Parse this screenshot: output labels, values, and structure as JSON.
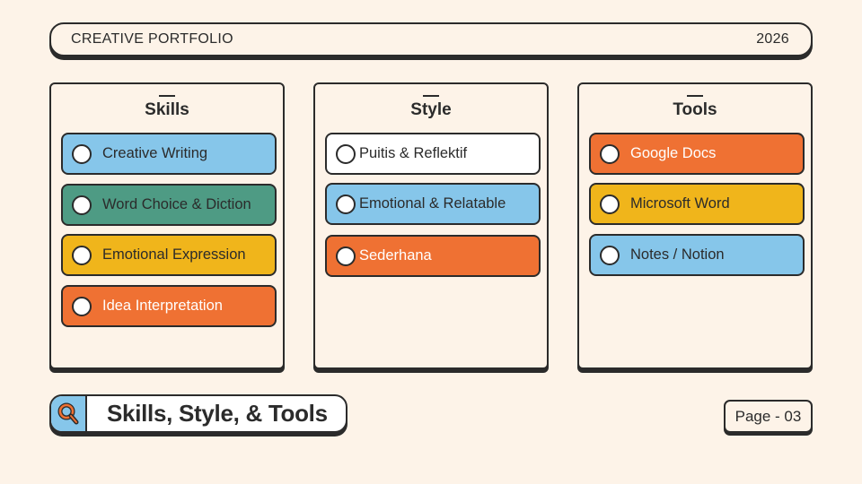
{
  "header": {
    "title": "CREATIVE PORTFOLIO",
    "year": "2026"
  },
  "columns": [
    {
      "title": "Skills",
      "items": [
        {
          "label": "Creative Writing",
          "color": "#86c6ea"
        },
        {
          "label": "Word Choice & Diction",
          "color": "#4e9b84"
        },
        {
          "label": "Emotional Expression",
          "color": "#f0b51b"
        },
        {
          "label": "Idea Interpretation",
          "color": "#ef7133"
        }
      ]
    },
    {
      "title": "Style",
      "items": [
        {
          "label": "Puitis & Reflektif",
          "color": "#ffffff"
        },
        {
          "label": "Emotional & Relatable",
          "color": "#86c6ea"
        },
        {
          "label": "Sederhana",
          "color": "#ef7133"
        }
      ]
    },
    {
      "title": "Tools",
      "items": [
        {
          "label": "Google Docs",
          "color": "#ef7133"
        },
        {
          "label": "Microsoft Word",
          "color": "#f0b51b"
        },
        {
          "label": "Notes / Notion",
          "color": "#86c6ea"
        }
      ]
    }
  ],
  "footer": {
    "title": "Skills, Style, & Tools",
    "page": "Page - 03",
    "icon": "magnifier-icon"
  }
}
